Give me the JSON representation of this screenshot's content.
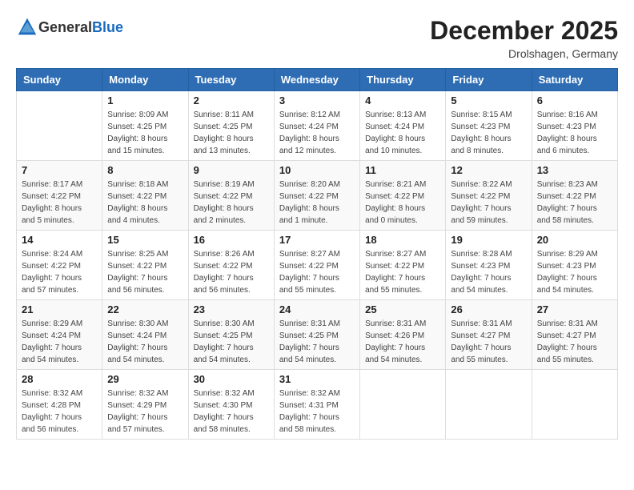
{
  "header": {
    "logo_general": "General",
    "logo_blue": "Blue",
    "month_title": "December 2025",
    "location": "Drolshagen, Germany"
  },
  "weekdays": [
    "Sunday",
    "Monday",
    "Tuesday",
    "Wednesday",
    "Thursday",
    "Friday",
    "Saturday"
  ],
  "weeks": [
    [
      {
        "day": "",
        "info": ""
      },
      {
        "day": "1",
        "info": "Sunrise: 8:09 AM\nSunset: 4:25 PM\nDaylight: 8 hours\nand 15 minutes."
      },
      {
        "day": "2",
        "info": "Sunrise: 8:11 AM\nSunset: 4:25 PM\nDaylight: 8 hours\nand 13 minutes."
      },
      {
        "day": "3",
        "info": "Sunrise: 8:12 AM\nSunset: 4:24 PM\nDaylight: 8 hours\nand 12 minutes."
      },
      {
        "day": "4",
        "info": "Sunrise: 8:13 AM\nSunset: 4:24 PM\nDaylight: 8 hours\nand 10 minutes."
      },
      {
        "day": "5",
        "info": "Sunrise: 8:15 AM\nSunset: 4:23 PM\nDaylight: 8 hours\nand 8 minutes."
      },
      {
        "day": "6",
        "info": "Sunrise: 8:16 AM\nSunset: 4:23 PM\nDaylight: 8 hours\nand 6 minutes."
      }
    ],
    [
      {
        "day": "7",
        "info": "Sunrise: 8:17 AM\nSunset: 4:22 PM\nDaylight: 8 hours\nand 5 minutes."
      },
      {
        "day": "8",
        "info": "Sunrise: 8:18 AM\nSunset: 4:22 PM\nDaylight: 8 hours\nand 4 minutes."
      },
      {
        "day": "9",
        "info": "Sunrise: 8:19 AM\nSunset: 4:22 PM\nDaylight: 8 hours\nand 2 minutes."
      },
      {
        "day": "10",
        "info": "Sunrise: 8:20 AM\nSunset: 4:22 PM\nDaylight: 8 hours\nand 1 minute."
      },
      {
        "day": "11",
        "info": "Sunrise: 8:21 AM\nSunset: 4:22 PM\nDaylight: 8 hours\nand 0 minutes."
      },
      {
        "day": "12",
        "info": "Sunrise: 8:22 AM\nSunset: 4:22 PM\nDaylight: 7 hours\nand 59 minutes."
      },
      {
        "day": "13",
        "info": "Sunrise: 8:23 AM\nSunset: 4:22 PM\nDaylight: 7 hours\nand 58 minutes."
      }
    ],
    [
      {
        "day": "14",
        "info": "Sunrise: 8:24 AM\nSunset: 4:22 PM\nDaylight: 7 hours\nand 57 minutes."
      },
      {
        "day": "15",
        "info": "Sunrise: 8:25 AM\nSunset: 4:22 PM\nDaylight: 7 hours\nand 56 minutes."
      },
      {
        "day": "16",
        "info": "Sunrise: 8:26 AM\nSunset: 4:22 PM\nDaylight: 7 hours\nand 56 minutes."
      },
      {
        "day": "17",
        "info": "Sunrise: 8:27 AM\nSunset: 4:22 PM\nDaylight: 7 hours\nand 55 minutes."
      },
      {
        "day": "18",
        "info": "Sunrise: 8:27 AM\nSunset: 4:22 PM\nDaylight: 7 hours\nand 55 minutes."
      },
      {
        "day": "19",
        "info": "Sunrise: 8:28 AM\nSunset: 4:23 PM\nDaylight: 7 hours\nand 54 minutes."
      },
      {
        "day": "20",
        "info": "Sunrise: 8:29 AM\nSunset: 4:23 PM\nDaylight: 7 hours\nand 54 minutes."
      }
    ],
    [
      {
        "day": "21",
        "info": "Sunrise: 8:29 AM\nSunset: 4:24 PM\nDaylight: 7 hours\nand 54 minutes."
      },
      {
        "day": "22",
        "info": "Sunrise: 8:30 AM\nSunset: 4:24 PM\nDaylight: 7 hours\nand 54 minutes."
      },
      {
        "day": "23",
        "info": "Sunrise: 8:30 AM\nSunset: 4:25 PM\nDaylight: 7 hours\nand 54 minutes."
      },
      {
        "day": "24",
        "info": "Sunrise: 8:31 AM\nSunset: 4:25 PM\nDaylight: 7 hours\nand 54 minutes."
      },
      {
        "day": "25",
        "info": "Sunrise: 8:31 AM\nSunset: 4:26 PM\nDaylight: 7 hours\nand 54 minutes."
      },
      {
        "day": "26",
        "info": "Sunrise: 8:31 AM\nSunset: 4:27 PM\nDaylight: 7 hours\nand 55 minutes."
      },
      {
        "day": "27",
        "info": "Sunrise: 8:31 AM\nSunset: 4:27 PM\nDaylight: 7 hours\nand 55 minutes."
      }
    ],
    [
      {
        "day": "28",
        "info": "Sunrise: 8:32 AM\nSunset: 4:28 PM\nDaylight: 7 hours\nand 56 minutes."
      },
      {
        "day": "29",
        "info": "Sunrise: 8:32 AM\nSunset: 4:29 PM\nDaylight: 7 hours\nand 57 minutes."
      },
      {
        "day": "30",
        "info": "Sunrise: 8:32 AM\nSunset: 4:30 PM\nDaylight: 7 hours\nand 58 minutes."
      },
      {
        "day": "31",
        "info": "Sunrise: 8:32 AM\nSunset: 4:31 PM\nDaylight: 7 hours\nand 58 minutes."
      },
      {
        "day": "",
        "info": ""
      },
      {
        "day": "",
        "info": ""
      },
      {
        "day": "",
        "info": ""
      }
    ]
  ]
}
